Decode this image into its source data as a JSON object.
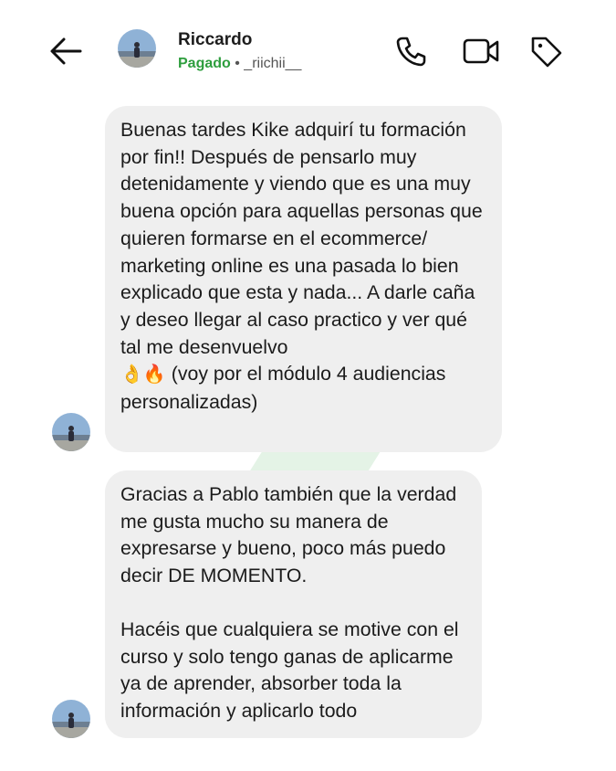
{
  "header": {
    "contact_name": "Riccardo",
    "status": "Pagado",
    "separator": " • ",
    "username": "_riichii__",
    "icons": [
      "back-arrow-icon",
      "phone-icon",
      "video-icon",
      "tag-icon"
    ]
  },
  "messages": [
    {
      "text": "Buenas tardes Kike adquirí tu formación por fin!! Después de pensarlo muy detenidamente y viendo que es una muy buena opción para aquellas personas que quieren formarse en el ecommerce/ marketing online es una pasada lo bien explicado que esta y nada... A darle caña y deseo llegar al caso practico y ver qué tal me desenvuelvo",
      "emojis": "👌🔥",
      "text_after_emoji": " (voy por el módulo 4 audiencias personalizadas)"
    },
    {
      "paragraph_1": "Gracias a Pablo también que la verdad me gusta mucho su manera de expresarse y bueno, poco más puedo decir DE MOMENTO.",
      "paragraph_2": "Hacéis que cualquiera se motive con el curso y solo tengo ganas de aplicarme ya de aprender, absorber toda la información y aplicarlo todo"
    }
  ],
  "colors": {
    "status_green": "#2e9e3e",
    "bubble_bg": "#efefef",
    "watermark": "#3aa64a"
  }
}
